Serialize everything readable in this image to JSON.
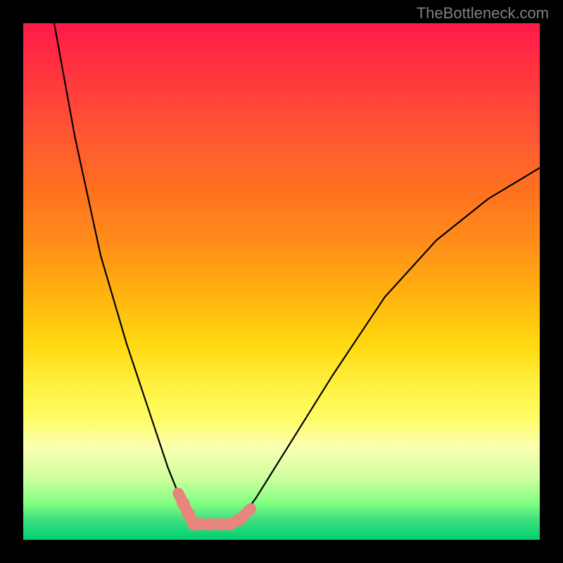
{
  "watermark": "TheBottleneck.com",
  "chart_data": {
    "type": "line",
    "title": "",
    "xlabel": "",
    "ylabel": "",
    "xlim": [
      0,
      100
    ],
    "ylim": [
      0,
      100
    ],
    "note": "Bottleneck percentage curve. Two black curves form a V shape with minimum (optimal match) around x≈33-42. Background gradient encodes bottleneck severity: green at bottom (0%, good), yellow middle, red at top (100%, bad). Pink/salmon markers near the bottom indicate specific hardware data points clustered around the optimal region.",
    "series": [
      {
        "name": "left-curve",
        "x": [
          6,
          10,
          15,
          20,
          25,
          28,
          30,
          32,
          33
        ],
        "y": [
          100,
          78,
          55,
          38,
          23,
          14,
          9,
          5,
          3
        ]
      },
      {
        "name": "right-curve",
        "x": [
          42,
          45,
          50,
          55,
          60,
          70,
          80,
          90,
          100
        ],
        "y": [
          4,
          8,
          16,
          24,
          32,
          47,
          58,
          66,
          72
        ]
      }
    ],
    "markers": {
      "name": "hardware-points",
      "color": "#e8857d",
      "points": [
        {
          "x": 30,
          "y": 9
        },
        {
          "x": 31,
          "y": 7
        },
        {
          "x": 32,
          "y": 5
        },
        {
          "x": 33,
          "y": 3
        },
        {
          "x": 34,
          "y": 3
        },
        {
          "x": 36,
          "y": 3
        },
        {
          "x": 38,
          "y": 3
        },
        {
          "x": 40,
          "y": 3
        },
        {
          "x": 42,
          "y": 4
        },
        {
          "x": 44,
          "y": 6
        }
      ]
    },
    "gradient_stops": [
      {
        "pct": 0,
        "color": "#ff1a4a"
      },
      {
        "pct": 50,
        "color": "#ffd000"
      },
      {
        "pct": 80,
        "color": "#fff060"
      },
      {
        "pct": 100,
        "color": "#00d070"
      }
    ]
  }
}
